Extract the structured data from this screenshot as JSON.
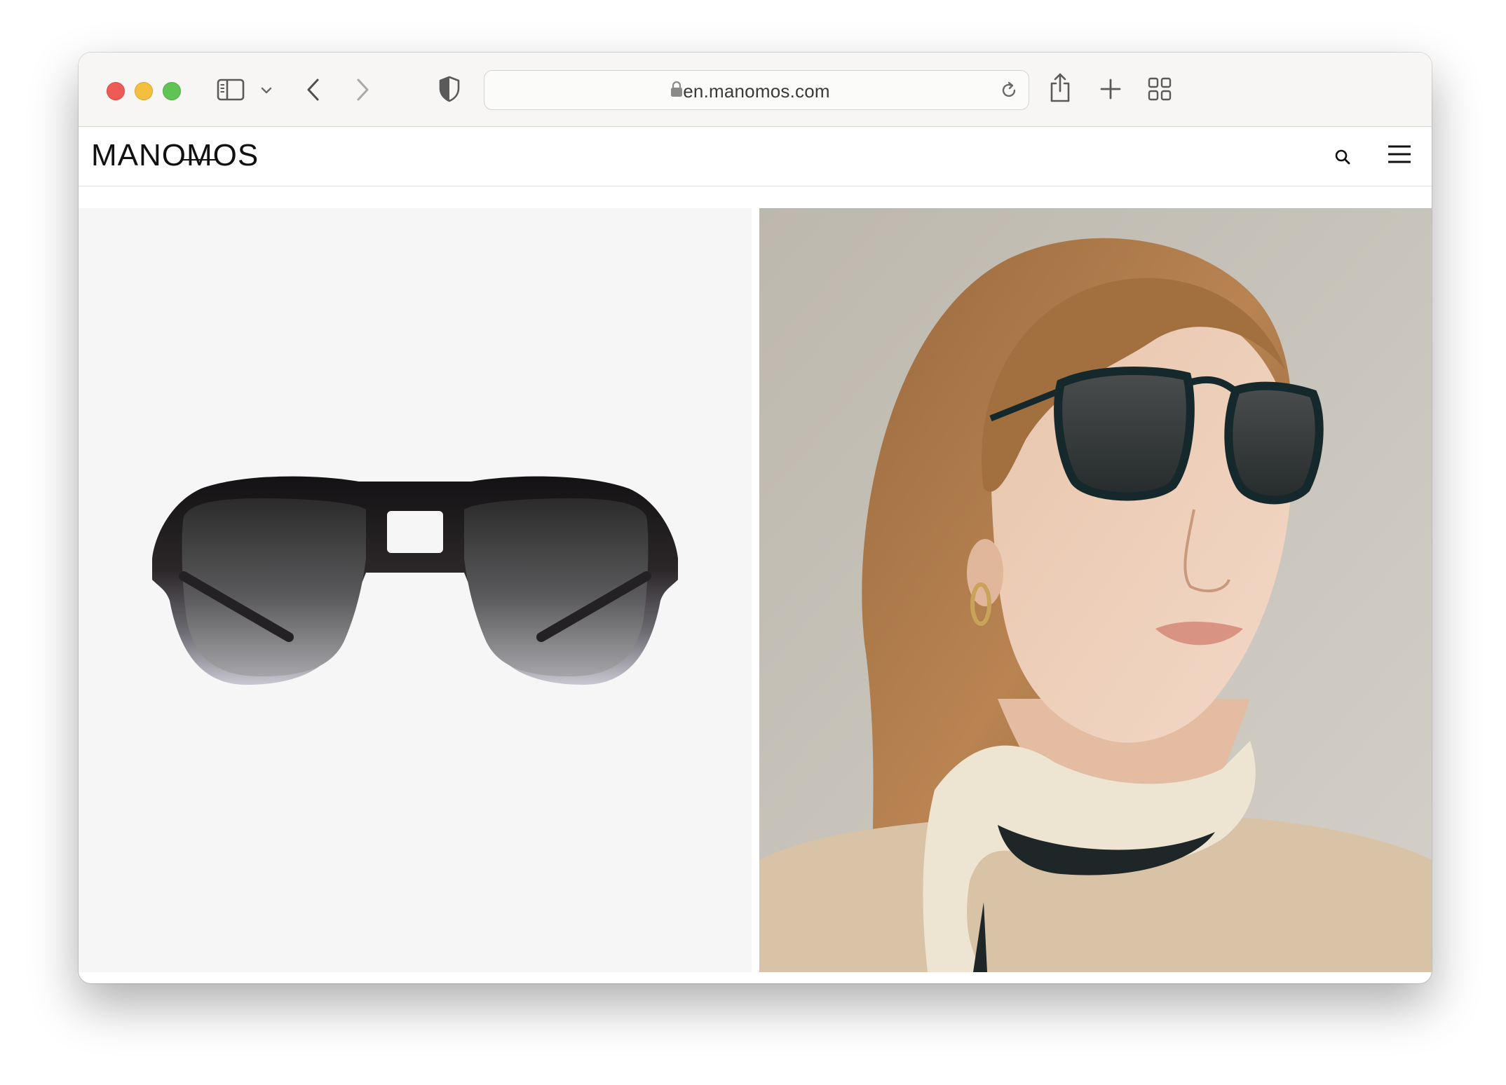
{
  "browser": {
    "url": "en.manomos.com"
  },
  "site": {
    "logo_text": "MANOMOS",
    "brand_color": "#111111"
  },
  "icons": {
    "sidebar": "sidebar-icon",
    "back": "chevron-left-icon",
    "forward": "chevron-right-icon",
    "shield": "shield-icon",
    "lock": "lock-icon",
    "reload": "reload-icon",
    "share": "share-icon",
    "new_tab": "plus-icon",
    "tabs": "tab-overview-icon",
    "search": "search-icon",
    "menu": "hamburger-menu-icon"
  },
  "images": {
    "left": "product-sunglasses-aviator",
    "right": "model-wearing-sunglasses"
  }
}
